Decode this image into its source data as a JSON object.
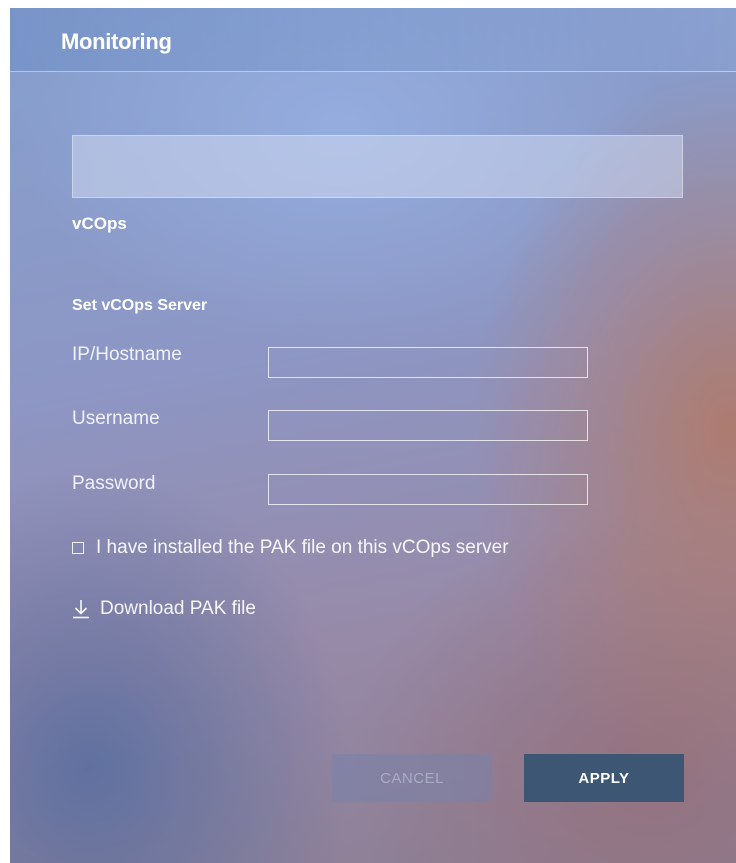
{
  "dialog": {
    "title": "Monitoring"
  },
  "section": {
    "heading": "vCOps",
    "subheading": "Set vCOps Server"
  },
  "form": {
    "fields": [
      {
        "label": "IP/Hostname",
        "value": "",
        "placeholder": ""
      },
      {
        "label": "Username",
        "value": "",
        "placeholder": ""
      },
      {
        "label": "Password",
        "value": "",
        "placeholder": ""
      }
    ],
    "checkbox_label": "I have installed the PAK file on this vCOps server",
    "checkbox_checked": false,
    "download_label": "Download PAK file"
  },
  "buttons": {
    "cancel_label": "CANCEL",
    "apply_label": "APPLY"
  },
  "icons": {
    "download": "download-icon",
    "checkbox": "checkbox-icon"
  },
  "colors": {
    "apply_button": "#3c5674",
    "text": "#ffffff"
  }
}
